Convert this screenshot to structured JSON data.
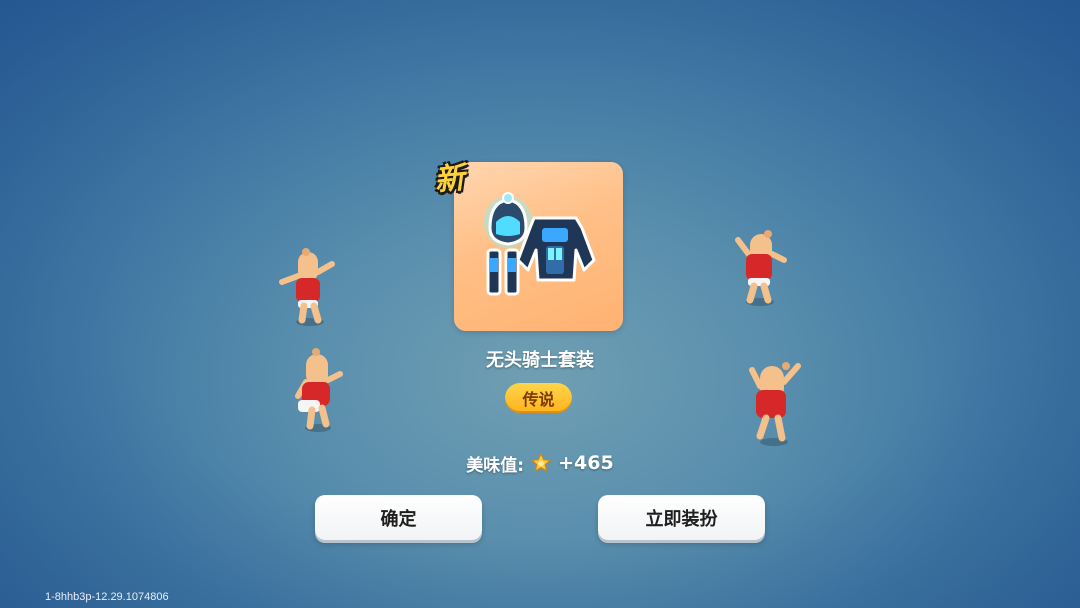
{
  "reward": {
    "new_badge": "新",
    "item_name": "无头骑士套装",
    "rarity": "传说",
    "score_label": "美味值:",
    "score_value": "+465"
  },
  "buttons": {
    "confirm_label": "确定",
    "equip_label": "立即装扮"
  },
  "footer": {
    "version": "1-8hhb3p-12.29.1074806"
  },
  "icons": {
    "new_badge": "new-badge-icon",
    "star": "star-icon",
    "outfit": "headless-knight-outfit-icon"
  },
  "colors": {
    "card_bg": "#ffbf86",
    "rarity_badge": "#ffb31f",
    "new_badge": "#ffd23a",
    "button_bg": "#ffffff"
  }
}
